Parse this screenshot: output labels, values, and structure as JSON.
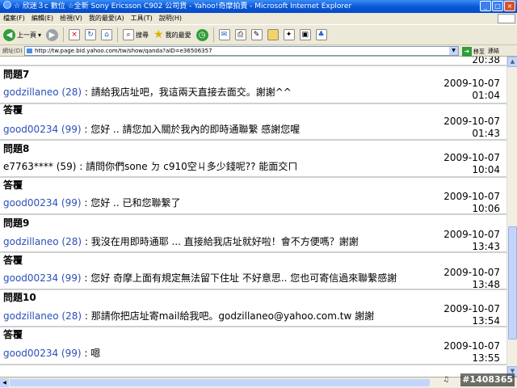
{
  "window": {
    "title": "☆ 欣迷３c 數位 ☆全新 Sony Ericsson C902 公司貨 - Yahoo!奇摩拍賣 - Microsoft Internet Explorer",
    "buttons": [
      "_",
      "□",
      "×"
    ]
  },
  "menu": [
    "檔案(F)",
    "編輯(E)",
    "檢視(V)",
    "我的最愛(A)",
    "工具(T)",
    "說明(H)"
  ],
  "toolbar": {
    "back": "上一頁",
    "search": "搜尋",
    "favorites": "我的最愛"
  },
  "address": {
    "label": "網址(D)",
    "url": "http://tw.page.bid.yahoo.com/tw/show/qanda?aID=e36506357",
    "go": "移至",
    "links": "連結"
  },
  "top_time": "20:38",
  "entries": [
    {
      "type": "q",
      "label": "問題7",
      "user": "godzillaneo",
      "rating": "(28)",
      "text": " : 請給我店址吧，我這兩天直接去面交。謝謝^^",
      "date": "2009-10-07",
      "time": "01:04"
    },
    {
      "type": "a",
      "label": "答覆",
      "user": "good00234",
      "rating": "(99)",
      "text": " : 您好 .. 請您加入關於我內的即時通聯繫 感謝您喔",
      "date": "2009-10-07",
      "time": "01:43"
    },
    {
      "type": "q",
      "label": "問題8",
      "user": "e7763****",
      "rating": "(59)",
      "text": " : 請問你們sone ㄉ c910空ㄐ多少錢呢?? 能面交ㄇ",
      "date": "2009-10-07",
      "time": "10:04"
    },
    {
      "type": "a",
      "label": "答覆",
      "user": "good00234",
      "rating": "(99)",
      "text": " : 您好 .. 已和您聯繫了",
      "date": "2009-10-07",
      "time": "10:06"
    },
    {
      "type": "q",
      "label": "問題9",
      "user": "godzillaneo",
      "rating": "(28)",
      "text": " : 我沒在用即時通耶 ... 直接給我店址就好啦！會不方便嗎？謝謝",
      "date": "2009-10-07",
      "time": "13:43"
    },
    {
      "type": "a",
      "label": "答覆",
      "user": "good00234",
      "rating": "(99)",
      "text": " : 您好 奇摩上面有規定無法留下住址 不好意思.. 您也可寄信過來聯繫感謝",
      "date": "2009-10-07",
      "time": "13:48"
    },
    {
      "type": "q",
      "label": "問題10",
      "user": "godzillaneo",
      "rating": "(28)",
      "text": " : 那請你把店址寄mail給我吧。godzillaneo@yahoo.com.tw 謝謝",
      "date": "2009-10-07",
      "time": "13:54"
    },
    {
      "type": "a",
      "label": "答覆",
      "user": "good00234",
      "rating": "(99)",
      "text": " : 嗯",
      "date": "2009-10-07",
      "time": "13:55"
    }
  ],
  "watermark": "#1408365"
}
